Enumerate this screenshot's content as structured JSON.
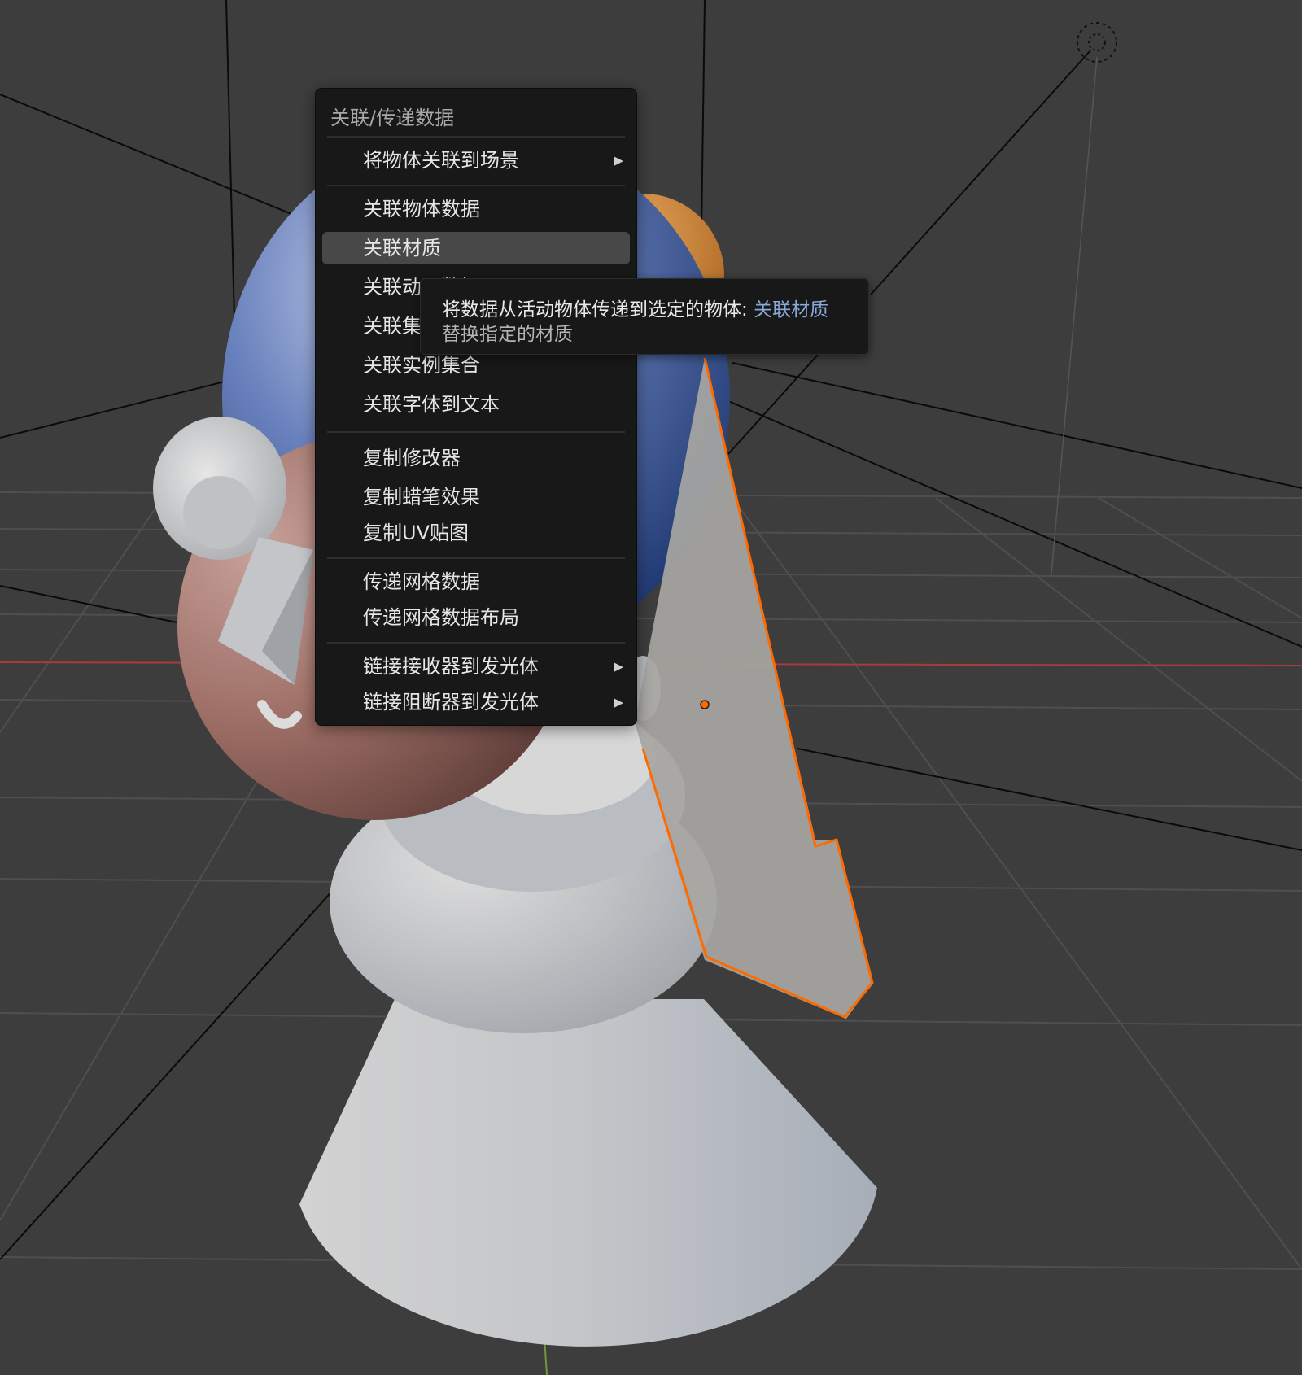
{
  "menu": {
    "title": "关联/传递数据",
    "groups": [
      {
        "items": [
          {
            "label": "将物体关联到场景",
            "submenu": true,
            "arrow": "▶"
          }
        ]
      },
      {
        "items": [
          {
            "label": "关联物体数据"
          },
          {
            "label": "关联材质",
            "active": true
          },
          {
            "label": "关联动画数据"
          },
          {
            "label": "关联集合"
          },
          {
            "label": "关联实例集合"
          },
          {
            "label": "关联字体到文本"
          }
        ]
      },
      {
        "items": [
          {
            "label": "复制修改器"
          },
          {
            "label": "复制蜡笔效果"
          },
          {
            "label": "复制UV贴图"
          }
        ]
      },
      {
        "items": [
          {
            "label": "传递网格数据"
          },
          {
            "label": "传递网格数据布局"
          }
        ]
      },
      {
        "items": [
          {
            "label": "链接接收器到发光体",
            "submenu": true,
            "arrow": "▶"
          },
          {
            "label": "链接阻断器到发光体",
            "submenu": true,
            "arrow": "▶"
          }
        ]
      }
    ]
  },
  "tooltip": {
    "description": "将数据从活动物体传递到选定的物体: ",
    "operator": "关联材质",
    "detail": "替换指定的材质"
  },
  "colors": {
    "viewport_bg": "#3d3d3d",
    "menu_bg": "#181818",
    "menu_highlight": "#484848",
    "selection_outline": "#ff6a00",
    "x_axis": "#a83b3b",
    "z_axis": "#6f9a3c",
    "tooltip_operator": "#8aa9d8"
  }
}
